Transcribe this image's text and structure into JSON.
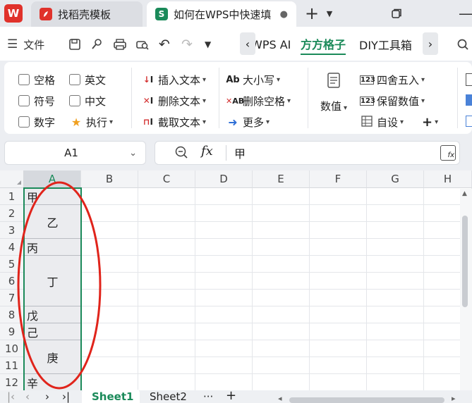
{
  "titlebar": {
    "logo_text": "W",
    "tabs": [
      {
        "label": "找稻壳模板",
        "icon": "docer-icon",
        "icon_color": "#e0322b"
      },
      {
        "label": "如何在WPS中快速填",
        "icon": "spreadsheet-icon",
        "icon_color": "#1b8a5a",
        "icon_text": "S",
        "dot": "●"
      }
    ],
    "new_tab": "+"
  },
  "menubar": {
    "file_label": "文件",
    "ribbon_tabs": [
      "WPS AI",
      "方方格子",
      "DIY工具箱"
    ],
    "active_tab": "方方格子"
  },
  "ribbon": {
    "checks": [
      "空格",
      "英文",
      "符号",
      "中文",
      "数字"
    ],
    "execute_label": "执行",
    "text_ops": [
      "插入文本",
      "删除文本",
      "截取文本"
    ],
    "case_ops": [
      "大小写",
      "删除空格",
      "更多"
    ],
    "number_label": "数值",
    "number_ops": [
      "四舍五入",
      "保留数值",
      "自设"
    ]
  },
  "formula": {
    "cell_ref": "A1",
    "fx_symbol": "fx",
    "value": "甲"
  },
  "grid": {
    "columns": [
      "A",
      "B",
      "C",
      "D",
      "E",
      "F",
      "G",
      "H"
    ],
    "rows": [
      "1",
      "2",
      "3",
      "4",
      "5",
      "6",
      "7",
      "8",
      "9",
      "10",
      "11",
      "12"
    ],
    "column_a": [
      {
        "text": "甲",
        "span": 1
      },
      {
        "text": "乙",
        "span": 2
      },
      {
        "text": "丙",
        "span": 1
      },
      {
        "text": "丁",
        "span": 3
      },
      {
        "text": "戊",
        "span": 1
      },
      {
        "text": "己",
        "span": 1
      },
      {
        "text": "庚",
        "span": 2
      },
      {
        "text": "辛",
        "span": 1
      }
    ]
  },
  "sheets": {
    "tabs": [
      "Sheet1",
      "Sheet2"
    ],
    "active": "Sheet1",
    "more": "···",
    "add": "+"
  },
  "colors": {
    "accent": "#1b8a5a",
    "annotation": "#e0241b"
  }
}
